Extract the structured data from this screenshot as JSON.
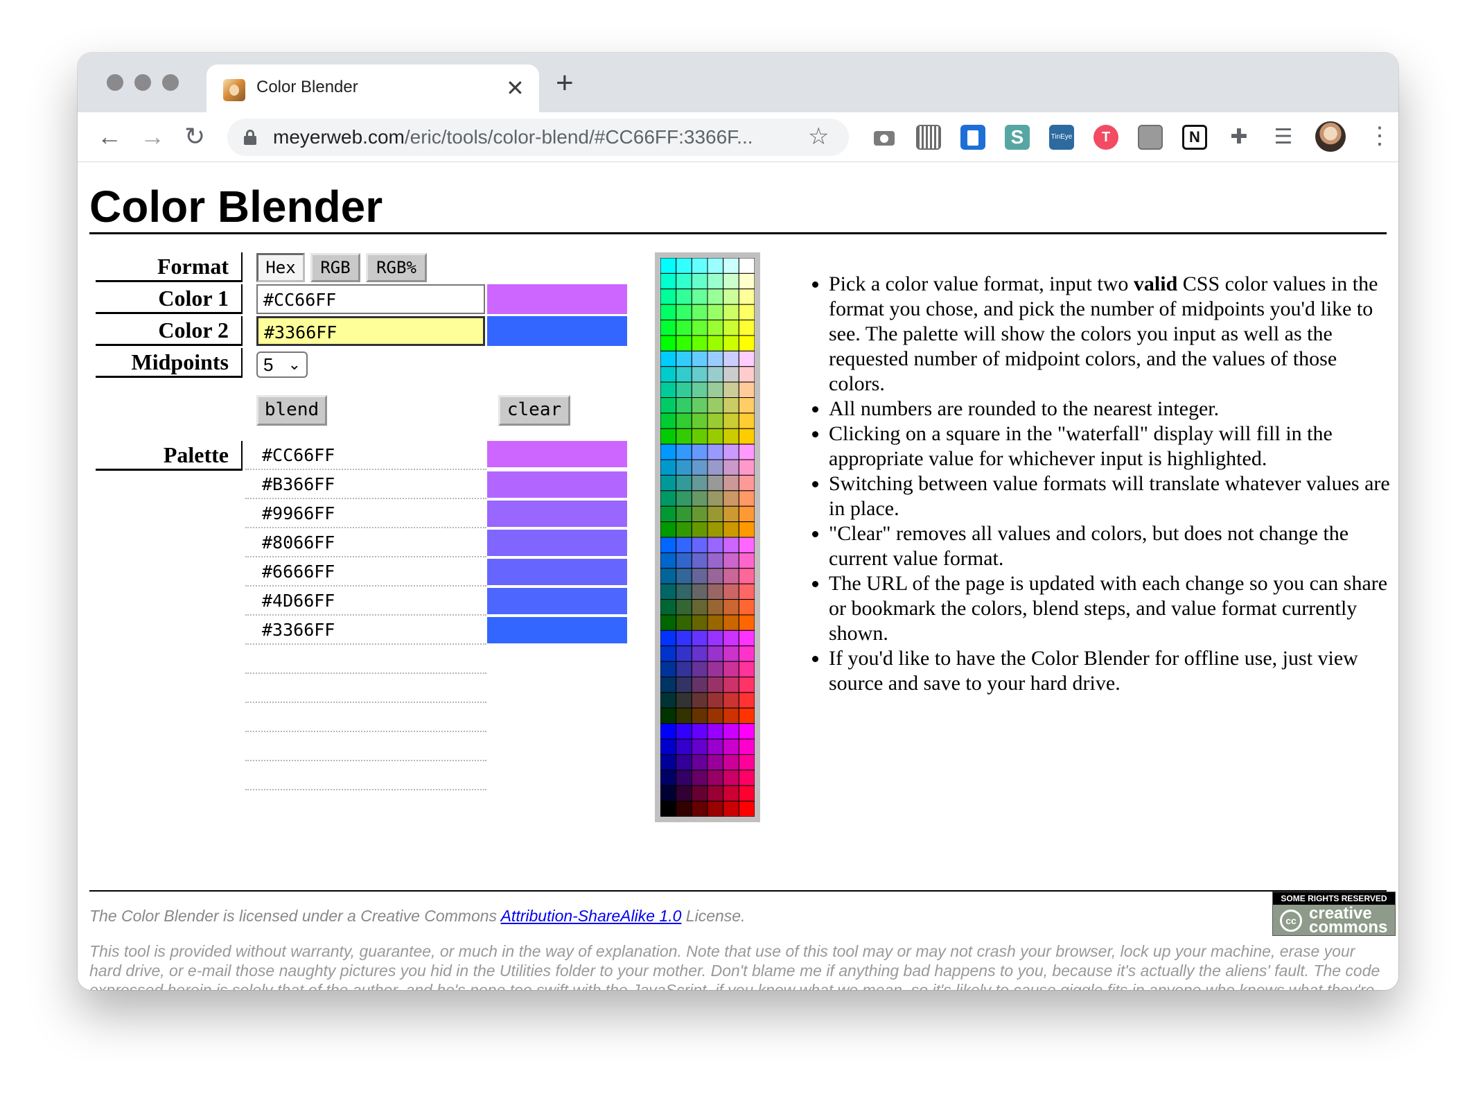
{
  "browser": {
    "tab_title": "Color Blender",
    "tab_close": "✕",
    "new_tab": "+",
    "url_host": "meyerweb.com",
    "url_path": "/eric/tools/color-blend/#CC66FF:3366F...",
    "back": "←",
    "forward": "→",
    "reload": "↻",
    "star": "☆",
    "extensions": [
      "camera-icon",
      "barcode-icon",
      "trello-icon",
      "s-extension-icon",
      "tineye-icon",
      "red-extension-icon",
      "wix-icon",
      "notion-icon",
      "puzzle-icon",
      "media-queue-icon"
    ],
    "ext_s_text": "S",
    "ext_tineye_text": "TinEye",
    "ext_red_text": "T",
    "ext_notion_text": "N",
    "ext_puzzle_text": "✚",
    "ext_queue_text": "☰",
    "menu_dots": "⋮"
  },
  "page": {
    "title": "Color Blender",
    "labels": {
      "format": "Format",
      "color1": "Color 1",
      "color2": "Color 2",
      "midpoints": "Midpoints",
      "palette": "Palette"
    },
    "format_buttons": [
      "Hex",
      "RGB",
      "RGB%"
    ],
    "active_format": "Hex",
    "color1": {
      "value": "#CC66FF",
      "swatch": "#CC66FF"
    },
    "color2": {
      "value": "#3366FF",
      "swatch": "#3366FF"
    },
    "midpoints": {
      "selected": "5",
      "arrow": "⌄"
    },
    "blend_button": "blend",
    "clear_button": "clear",
    "palette": [
      {
        "value": "#CC66FF",
        "color": "#CC66FF"
      },
      {
        "value": "#B366FF",
        "color": "#B366FF"
      },
      {
        "value": "#9966FF",
        "color": "#9966FF"
      },
      {
        "value": "#8066FF",
        "color": "#8066FF"
      },
      {
        "value": "#6666FF",
        "color": "#6666FF"
      },
      {
        "value": "#4D66FF",
        "color": "#4D66FF"
      },
      {
        "value": "#3366FF",
        "color": "#3366FF"
      }
    ],
    "notes": [
      {
        "pre": "Pick a color value format, input two ",
        "bold": "valid",
        "post": " CSS color values in the format you chose, and pick the number of midpoints you'd like to see. The palette will show the colors you input as well as the requested number of midpoint colors, and the values of those colors."
      },
      {
        "pre": "All numbers are rounded to the nearest integer.",
        "bold": "",
        "post": ""
      },
      {
        "pre": "Clicking on a square in the \"waterfall\" display will fill in the appropriate value for whichever input is highlighted.",
        "bold": "",
        "post": ""
      },
      {
        "pre": "Switching between value formats will translate whatever values are in place.",
        "bold": "",
        "post": ""
      },
      {
        "pre": "\"Clear\" removes all values and colors, but does not change the current value format.",
        "bold": "",
        "post": ""
      },
      {
        "pre": "The URL of the page is updated with each change so you can share or bookmark the colors, blend steps, and value format currently shown.",
        "bold": "",
        "post": ""
      },
      {
        "pre": "If you'd like to have the Color Blender for offline use, just view source and save to your hard drive.",
        "bold": "",
        "post": ""
      }
    ],
    "license_pre": "The Color Blender is licensed under a Creative Commons ",
    "license_link": "Attribution-ShareAlike 1.0",
    "license_post": " License.",
    "cc_top": "SOME RIGHTS RESERVED",
    "cc_symbol": "cc",
    "cc_word1": "creative",
    "cc_word2": "commons",
    "disclaimer": "This tool is provided without warranty, guarantee, or much in the way of explanation. Note that use of this tool may or may not crash your browser, lock up your machine, erase your hard drive, or e-mail those naughty pictures you hid in the Utilities folder to your mother. Don't blame me if anything bad happens to you, because it's actually the aliens' fault. The code expressed herein is solely that of the author, and he's none too swift with the JavaScript, if you know what we mean, so it's likely to cause giggle fits in anyone who knows what they're doing. Not a flying toy. Thank you for playing. Insert coin to continue."
  }
}
